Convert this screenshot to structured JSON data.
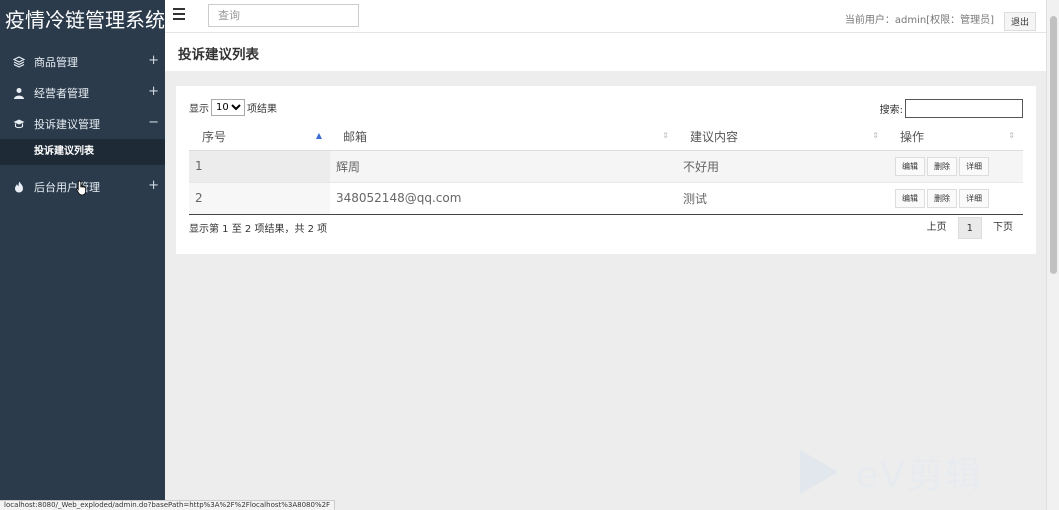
{
  "brand": {
    "title": "疫情冷链管理系统"
  },
  "sidebar": {
    "items": [
      {
        "label": "商品管理",
        "icon": "layers-icon",
        "toggle": "+"
      },
      {
        "label": "经营者管理",
        "icon": "user-icon",
        "toggle": "+"
      },
      {
        "label": "投诉建议管理",
        "icon": "graduation-cap-icon",
        "toggle": "−",
        "sub": [
          {
            "label": "投诉建议列表"
          }
        ]
      },
      {
        "label": "后台用户管理",
        "icon": "fire-icon",
        "toggle": "+"
      }
    ]
  },
  "topbar": {
    "search_placeholder": "查询",
    "user_info": "当前用户：admin[权限：管理员]",
    "logout_label": "退出"
  },
  "page": {
    "title": "投诉建议列表"
  },
  "table_controls": {
    "show_prefix": "显示",
    "page_length": "10",
    "show_suffix": "项结果",
    "search_label": "搜索:",
    "search_value": ""
  },
  "table": {
    "columns": [
      "序号",
      "邮箱",
      "建议内容",
      "操作"
    ],
    "rows": [
      {
        "id": "1",
        "email": "辉周",
        "content": "不好用"
      },
      {
        "id": "2",
        "email": "348052148@qq.com",
        "content": "测试"
      }
    ],
    "actions": {
      "edit": "编辑",
      "delete": "删除",
      "detail": "详细"
    }
  },
  "pagination": {
    "info": "显示第 1 至 2 项结果，共 2 项",
    "prev": "上页",
    "current": "1",
    "next": "下页"
  },
  "status_bar": {
    "url": "localhost:8080/_Web_exploded/admin.do?basePath=http%3A%2F%2Flocalhost%3A8080%2F"
  },
  "watermark": {
    "text": "eV剪辑"
  },
  "colors": {
    "sidebar_bg": "#2b3b4c",
    "sidebar_active_sub": "#1e2a36",
    "sort_active": "#3c6fd6"
  }
}
